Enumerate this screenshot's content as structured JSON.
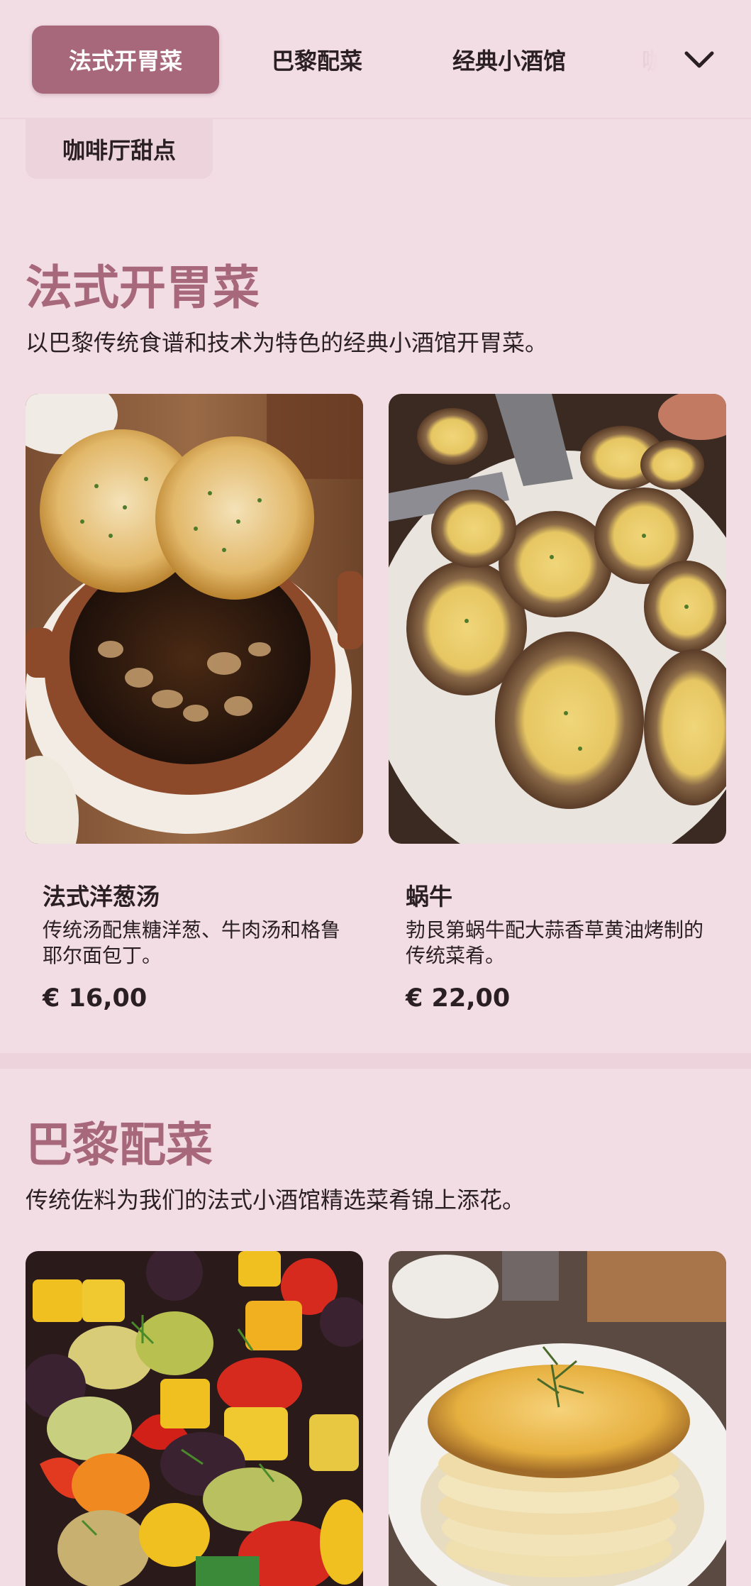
{
  "tabs": [
    {
      "label": "法式开胃菜",
      "active": true
    },
    {
      "label": "巴黎配菜",
      "active": false
    },
    {
      "label": "经典小酒馆",
      "active": false
    },
    {
      "label": "咖",
      "active": false
    },
    {
      "label": "咖啡厅甜点",
      "active": false
    }
  ],
  "expand_icon": "chevron-down-icon",
  "sections": [
    {
      "title": "法式开胃菜",
      "description": "以巴黎传统食谱和技术为特色的经典小酒馆开胃菜。",
      "items": [
        {
          "name": "法式洋葱汤",
          "description": "传统汤配焦糖洋葱、牛肉汤和格鲁耶尔面包丁。",
          "price": "€ 16,00",
          "photo": "onion-soup-photo"
        },
        {
          "name": "蜗牛",
          "description": "勃艮第蜗牛配大蒜香草黄油烤制的传统菜肴。",
          "price": "€ 22,00",
          "photo": "escargot-photo"
        }
      ]
    },
    {
      "title": "巴黎配菜",
      "description": "传统佐料为我们的法式小酒馆精选菜肴锦上添花。",
      "items": [
        {
          "photo": "ratatouille-photo"
        },
        {
          "photo": "gratin-photo"
        }
      ]
    }
  ],
  "colors": {
    "background": "#f3dde5",
    "accent": "#a8687c",
    "text": "#2a1f23"
  }
}
